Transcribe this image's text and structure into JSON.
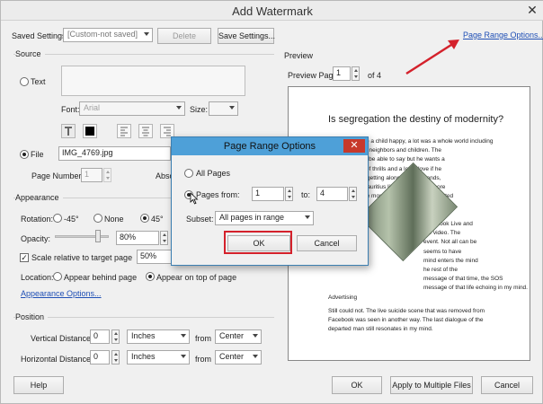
{
  "window": {
    "title": "Add Watermark",
    "close_glyph": "✕"
  },
  "top": {
    "saved_settings_label": "Saved Settings:",
    "saved_settings_value": "[Custom-not saved]",
    "delete_label": "Delete",
    "save_settings_label": "Save Settings...",
    "page_range_link": "Page Range Options..."
  },
  "source": {
    "section_title": "Source",
    "text_label": "Text",
    "font_label": "Font:",
    "font_value": "Arial",
    "size_label": "Size:",
    "file_label": "File",
    "file_value": "IMG_4769.jpg",
    "page_number_label": "Page Number:",
    "page_number_value": "1",
    "absolute_label": "Abso"
  },
  "appearance": {
    "section_title": "Appearance",
    "rotation_label": "Rotation:",
    "rot_neg45": "-45°",
    "rot_none": "None",
    "rot_45": "45°",
    "opacity_label": "Opacity:",
    "opacity_value": "80%",
    "opacity_level": 0.8,
    "scale_label": "Scale relative to target page",
    "scale_value": "50%",
    "location_label": "Location:",
    "behind_label": "Appear behind page",
    "on_top_label": "Appear on top of page",
    "appearance_options_link": "Appearance Options..."
  },
  "position": {
    "section_title": "Position",
    "vertical_label": "Vertical Distance:",
    "vertical_value": "0",
    "vertical_unit": "Inches",
    "vertical_from": "from",
    "vertical_anchor": "Center",
    "horizontal_label": "Horizontal Distance:",
    "horizontal_value": "0",
    "horizontal_unit": "Inches",
    "horizontal_from": "from",
    "horizontal_anchor": "Center"
  },
  "preview": {
    "section_title": "Preview",
    "preview_page_label": "Preview Page",
    "preview_page_value": "1",
    "page_of": "of 4",
    "doc_title": "Is segregation the destiny of modernity?",
    "doc_lines_1": "In order to keep a child happy, a lot was a whole world including\nanimals, grass, neighbors and children. The\nparent may not be able to say but he wants a\nrelatives, a lot of thrills and a lot of love if he\nboyfriends are getting along with girlfriends,\ntemporary in Mauritius life. People want more\nwanted to share more than they have committed\nmore fear than",
    "doc_lines_2": "Facebook Live and\nthe video. The\nevent. Not all can be\nseems to have\nmind enters the mind\nhe rest of the\nmessage of that time, the SOS\nmessage of that life echoing in my mind.",
    "doc_heading_2": "Advertising",
    "doc_lines_3": "Still could not. The live suicide scene that was removed from\nFacebook was seen in another way. The last dialogue of the\ndeparted man still resonates in my mind."
  },
  "dialog": {
    "title": "Page Range Options",
    "close_glyph": "✕",
    "all_pages_label": "All Pages",
    "pages_from_label": "Pages from:",
    "from_value": "1",
    "to_label": "to:",
    "to_value": "4",
    "subset_label": "Subset:",
    "subset_value": "All pages in range",
    "ok_label": "OK",
    "cancel_label": "Cancel"
  },
  "bottom": {
    "help_label": "Help",
    "ok_label": "OK",
    "apply_multiple_label": "Apply to Multiple Files",
    "cancel_label": "Cancel"
  },
  "colors": {
    "annotation_red": "#d4212b",
    "dialog_title_bg": "#4ea0d8",
    "link": "#1f4fb5"
  }
}
